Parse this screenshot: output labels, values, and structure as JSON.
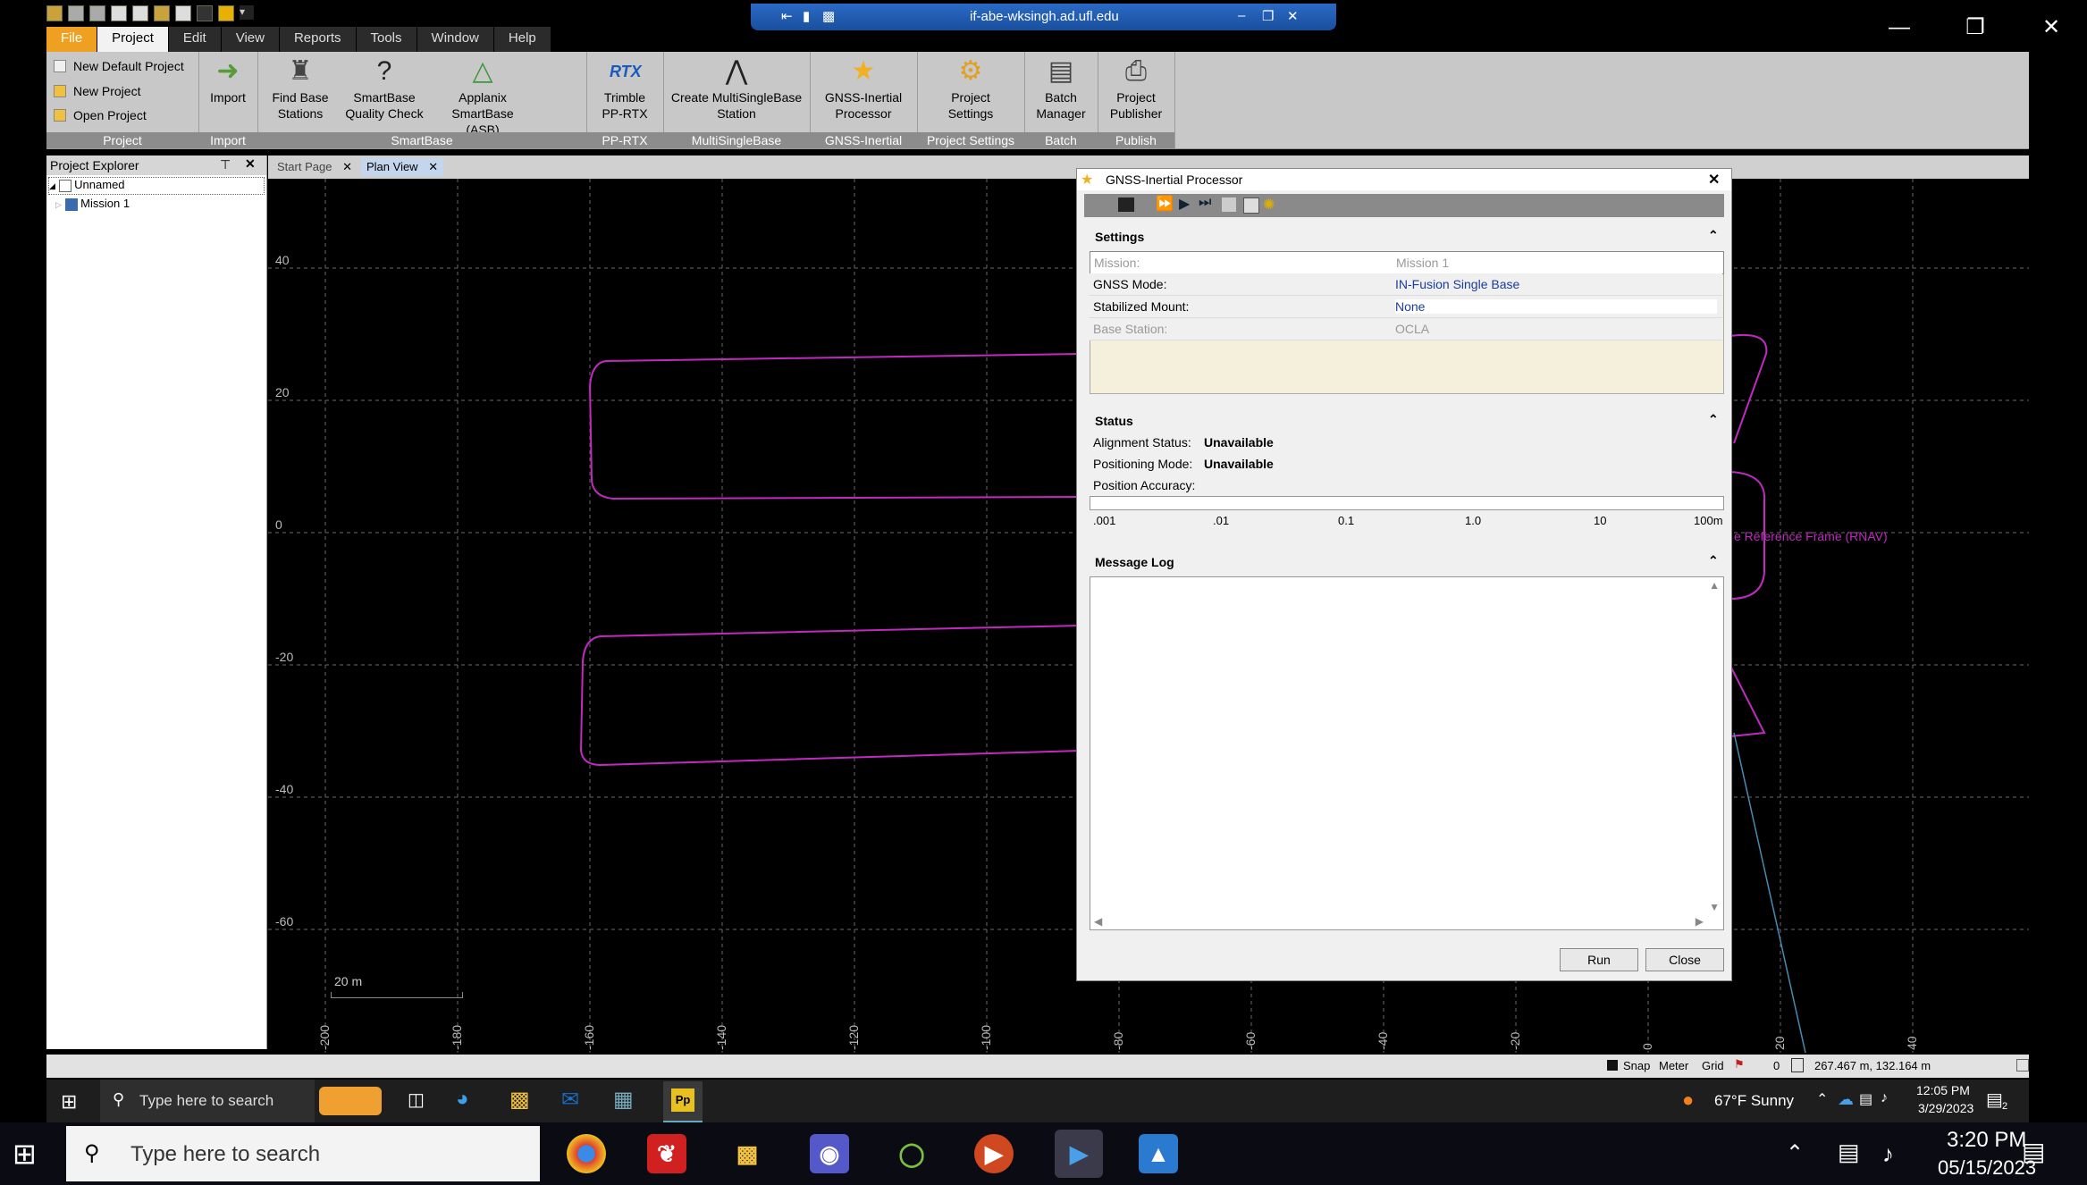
{
  "remote": {
    "host": "if-abe-wksingh.ad.ufl.edu"
  },
  "menus": [
    "File",
    "Project",
    "Edit",
    "View",
    "Reports",
    "Tools",
    "Window",
    "Help"
  ],
  "ribbon": {
    "project_items": [
      "New Default Project",
      "New Project",
      "Open Project"
    ],
    "groups": {
      "project": "Project",
      "import": "Import",
      "smartbase": "SmartBase",
      "pprtx": "PP-RTX",
      "msb": "MultiSingleBase",
      "gnss": "GNSS-Inertial",
      "settings": "Project Settings",
      "batch": "Batch",
      "publish": "Publish"
    },
    "buttons": {
      "import": "Import",
      "find_base": [
        "Find Base",
        "Stations"
      ],
      "smartbase_qc": [
        "SmartBase",
        "Quality Check"
      ],
      "applanix": [
        "Applanix",
        "SmartBase (ASB)"
      ],
      "trimble": [
        "Trimble",
        "PP-RTX"
      ],
      "create_msb": [
        "Create MultiSingleBase",
        "Station"
      ],
      "gnss_proc": [
        "GNSS-Inertial",
        "Processor"
      ],
      "proj_settings": [
        "Project",
        "Settings"
      ],
      "batch_mgr": [
        "Batch",
        "Manager"
      ],
      "proj_pub": [
        "Project",
        "Publisher"
      ],
      "rtx_badge": "RTX"
    }
  },
  "explorer": {
    "title": "Project Explorer",
    "root": "Unnamed",
    "child": "Mission 1"
  },
  "tabs": {
    "start": "Start Page",
    "plan": "Plan View"
  },
  "plan": {
    "y_labels": [
      "40",
      "20",
      "0",
      "-20",
      "-40",
      "-60"
    ],
    "x_labels": [
      "-200",
      "-180",
      "-160",
      "-140",
      "-120",
      "-100",
      "-80",
      "-60",
      "-40",
      "-20",
      "0",
      "20",
      "40"
    ],
    "scale_label": "20 m",
    "frame_label": "e Reference Frame (RNAV)"
  },
  "dialog": {
    "title": "GNSS-Inertial Processor",
    "settings_header": "Settings",
    "settings": [
      {
        "key": "Mission:",
        "value": "Mission 1"
      },
      {
        "key": "GNSS Mode:",
        "value": "IN-Fusion Single Base"
      },
      {
        "key": "Stabilized Mount:",
        "value": "None"
      },
      {
        "key": "Base Station:",
        "value": "OCLA"
      }
    ],
    "status_header": "Status",
    "alignment_label": "Alignment Status:",
    "alignment_value": "Unavailable",
    "positioning_label": "Positioning Mode:",
    "positioning_value": "Unavailable",
    "accuracy_label": "Position Accuracy:",
    "accuracy_scale": [
      ".001",
      ".01",
      "0.1",
      "1.0",
      "10",
      "100m"
    ],
    "log_header": "Message Log",
    "run": "Run",
    "close": "Close"
  },
  "statusbar": {
    "snap": "Snap",
    "meter": "Meter",
    "grid": "Grid",
    "zero": "0",
    "coords": "267.467 m, 132.164 m"
  },
  "taskbar_remote": {
    "search": "Type here to search",
    "weather": "67°F  Sunny",
    "time": "12:05 PM",
    "date": "3/29/2023",
    "notif": "2",
    "pp_badge": "Pp"
  },
  "taskbar_local": {
    "search": "Type here to search",
    "time": "3:20 PM",
    "date": "05/15/2023"
  },
  "colors": {
    "track": "#c02ac0",
    "accent": "#f0a020",
    "rdp_bar": "#2a6ac6"
  }
}
